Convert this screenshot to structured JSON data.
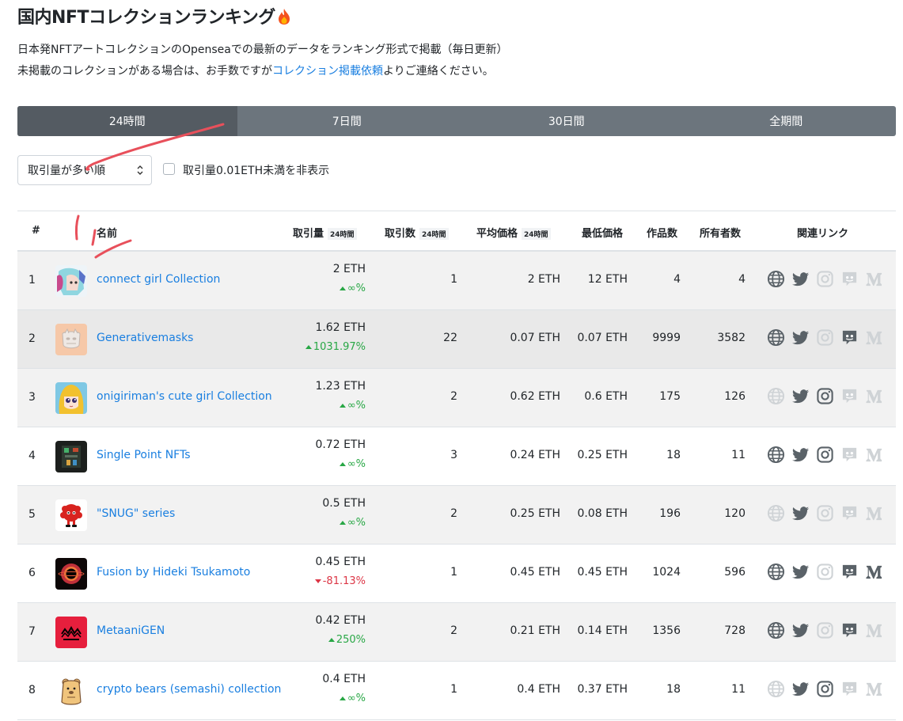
{
  "page": {
    "title": "国内NFTコレクションランキング",
    "desc1": "日本発NFTアートコレクションのOpenseaでの最新のデータをランキング形式で掲載（毎日更新）",
    "desc2_before": "未掲載のコレクションがある場合は、お手数ですが",
    "desc2_link": "コレクション掲載依頼",
    "desc2_after": "よりご連絡ください。"
  },
  "tabs": [
    {
      "label": "24時間",
      "active": true
    },
    {
      "label": "7日間",
      "active": false
    },
    {
      "label": "30日間",
      "active": false
    },
    {
      "label": "全期間",
      "active": false
    }
  ],
  "filters": {
    "sort_value": "取引量が多い順",
    "hide_label": "取引量0.01ETH未満を非表示",
    "hide_checked": false
  },
  "headers": {
    "rank": "#",
    "name": "名前",
    "volume": "取引量",
    "volume_sub": "24時間",
    "sales": "取引数",
    "sales_sub": "24時間",
    "avg": "平均価格",
    "avg_sub": "24時間",
    "floor": "最低価格",
    "items": "作品数",
    "owners": "所有者数",
    "links": "関連リンク"
  },
  "rows": [
    {
      "rank": "1",
      "name": "connect girl Collection",
      "volume": "2 ETH",
      "change": "∞%",
      "dir": "up",
      "sales": "1",
      "avg": "2 ETH",
      "floor": "12 ETH",
      "items": "4",
      "owners": "4",
      "links": [
        true,
        true,
        false,
        false,
        false
      ]
    },
    {
      "rank": "2",
      "name": "Generativemasks",
      "volume": "1.62 ETH",
      "change": "1031.97%",
      "dir": "up",
      "sales": "22",
      "avg": "0.07 ETH",
      "floor": "0.07 ETH",
      "items": "9999",
      "owners": "3582",
      "links": [
        true,
        true,
        false,
        true,
        false
      ]
    },
    {
      "rank": "3",
      "name": "onigiriman's cute girl Collection",
      "volume": "1.23 ETH",
      "change": "∞%",
      "dir": "up",
      "sales": "2",
      "avg": "0.62 ETH",
      "floor": "0.6 ETH",
      "items": "175",
      "owners": "126",
      "links": [
        false,
        true,
        true,
        false,
        false
      ]
    },
    {
      "rank": "4",
      "name": "Single Point NFTs",
      "volume": "0.72 ETH",
      "change": "∞%",
      "dir": "up",
      "sales": "3",
      "avg": "0.24 ETH",
      "floor": "0.25 ETH",
      "items": "18",
      "owners": "11",
      "links": [
        true,
        true,
        true,
        false,
        false
      ]
    },
    {
      "rank": "5",
      "name": "\"SNUG\" series",
      "volume": "0.5 ETH",
      "change": "∞%",
      "dir": "up",
      "sales": "2",
      "avg": "0.25 ETH",
      "floor": "0.08 ETH",
      "items": "196",
      "owners": "120",
      "links": [
        false,
        true,
        false,
        false,
        false
      ]
    },
    {
      "rank": "6",
      "name": "Fusion by Hideki Tsukamoto",
      "volume": "0.45 ETH",
      "change": "-81.13%",
      "dir": "down",
      "sales": "1",
      "avg": "0.45 ETH",
      "floor": "0.45 ETH",
      "items": "1024",
      "owners": "596",
      "links": [
        true,
        true,
        false,
        true,
        true
      ]
    },
    {
      "rank": "7",
      "name": "MetaaniGEN",
      "volume": "0.42 ETH",
      "change": "250%",
      "dir": "up",
      "sales": "2",
      "avg": "0.21 ETH",
      "floor": "0.14 ETH",
      "items": "1356",
      "owners": "728",
      "links": [
        true,
        true,
        false,
        true,
        false
      ]
    },
    {
      "rank": "8",
      "name": "crypto bears (semashi) collection",
      "volume": "0.4 ETH",
      "change": "∞%",
      "dir": "up",
      "sales": "1",
      "avg": "0.4 ETH",
      "floor": "0.37 ETH",
      "items": "18",
      "owners": "11",
      "links": [
        false,
        true,
        true,
        false,
        false
      ]
    }
  ],
  "link_icons": [
    "globe-icon",
    "twitter-icon",
    "instagram-icon",
    "discord-icon",
    "medium-icon"
  ],
  "colors": {
    "link": "#1a7fe0",
    "up": "#28a745",
    "down": "#dc3545",
    "tab_bg": "#6c757d",
    "tab_active": "#545b62",
    "annotation": "#e8505b"
  }
}
